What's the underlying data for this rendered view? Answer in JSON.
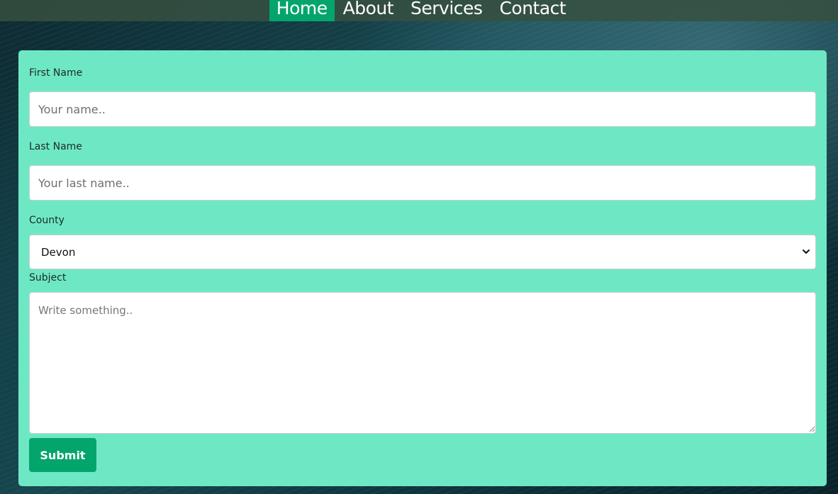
{
  "nav": {
    "items": [
      {
        "label": "Home",
        "active": true
      },
      {
        "label": "About",
        "active": false
      },
      {
        "label": "Services",
        "active": false
      },
      {
        "label": "Contact",
        "active": false
      }
    ]
  },
  "form": {
    "first_name": {
      "label": "First Name",
      "placeholder": "Your name.."
    },
    "last_name": {
      "label": "Last Name",
      "placeholder": "Your last name.."
    },
    "county": {
      "label": "County",
      "selected": "Devon",
      "icon": "chevron-down-icon"
    },
    "subject": {
      "label": "Subject",
      "placeholder": "Write something.."
    },
    "submit_label": "Submit"
  },
  "colors": {
    "accent": "#04a56c",
    "card_background": "#6ee8c4",
    "nav_background": "#37503f"
  }
}
